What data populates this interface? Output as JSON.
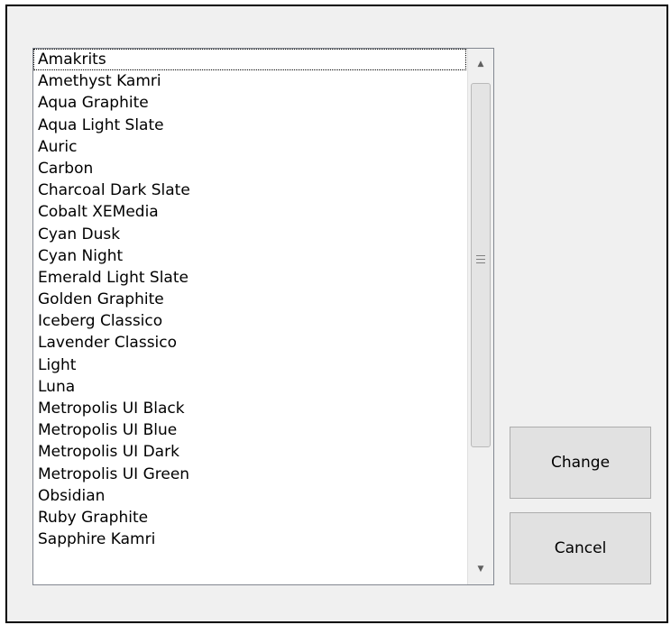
{
  "list": {
    "items": [
      "Amakrits",
      "Amethyst Kamri",
      "Aqua Graphite",
      "Aqua Light Slate",
      "Auric",
      "Carbon",
      "Charcoal Dark Slate",
      "Cobalt XEMedia",
      "Cyan Dusk",
      "Cyan Night",
      "Emerald Light Slate",
      "Golden Graphite",
      "Iceberg Classico",
      "Lavender Classico",
      "Light",
      "Luna",
      "Metropolis UI Black",
      "Metropolis UI Blue",
      "Metropolis UI Dark",
      "Metropolis UI Green",
      "Obsidian",
      "Ruby Graphite",
      "Sapphire Kamri"
    ],
    "focused_item": "Amakrits",
    "scroll_up_icon": "triangle-up",
    "scroll_down_icon": "triangle-down",
    "scroll_grip_icon": "grip-lines"
  },
  "buttons": {
    "change_label": "Change",
    "cancel_label": "Cancel"
  }
}
